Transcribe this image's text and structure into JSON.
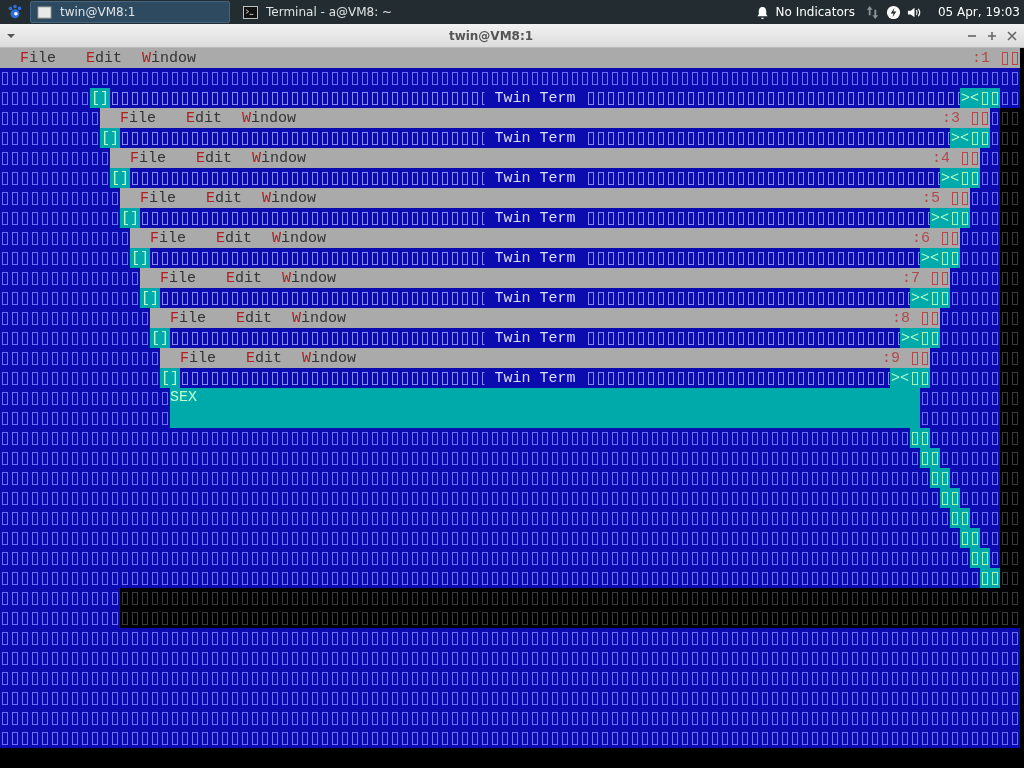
{
  "taskbar": {
    "tasks": [
      {
        "label": "twin@VM8:1",
        "selected": true
      },
      {
        "label": "Terminal - a@VM8: ~",
        "selected": false
      }
    ],
    "indicators": "No Indicators",
    "clock": "05 Apr, 19:03"
  },
  "window": {
    "title": "twin@VM8:1"
  },
  "terminal": {
    "menu_bar": {
      "items": [
        "File",
        "Edit",
        "Window"
      ],
      "status": ":1"
    },
    "windows": [
      {
        "close": "[]",
        "title": "Twin Term",
        "controls": "><",
        "menu_bar": {
          "items": [
            "File",
            "Edit",
            "Window"
          ],
          "status": ":3"
        }
      },
      {
        "close": "[]",
        "title": "Twin Term",
        "controls": "><",
        "menu_bar": {
          "items": [
            "File",
            "Edit",
            "Window"
          ],
          "status": ":4"
        }
      },
      {
        "close": "[]",
        "title": "Twin Term",
        "controls": "><",
        "menu_bar": {
          "items": [
            "File",
            "Edit",
            "Window"
          ],
          "status": ":5"
        }
      },
      {
        "close": "[]",
        "title": "Twin Term",
        "controls": "><",
        "menu_bar": {
          "items": [
            "File",
            "Edit",
            "Window"
          ],
          "status": ":6"
        }
      },
      {
        "close": "[]",
        "title": "Twin Term",
        "controls": "><",
        "menu_bar": {
          "items": [
            "File",
            "Edit",
            "Window"
          ],
          "status": ":7"
        }
      },
      {
        "close": "[]",
        "title": "Twin Term",
        "controls": "><",
        "menu_bar": {
          "items": [
            "File",
            "Edit",
            "Window"
          ],
          "status": ":8"
        }
      },
      {
        "close": "[]",
        "title": "Twin Term",
        "controls": "><",
        "menu_bar": {
          "items": [
            "File",
            "Edit",
            "Window"
          ],
          "status": ":9"
        }
      },
      {
        "close": "[]",
        "title": "Twin Term",
        "controls": "><"
      }
    ],
    "panel": {
      "text": "SEX"
    }
  }
}
